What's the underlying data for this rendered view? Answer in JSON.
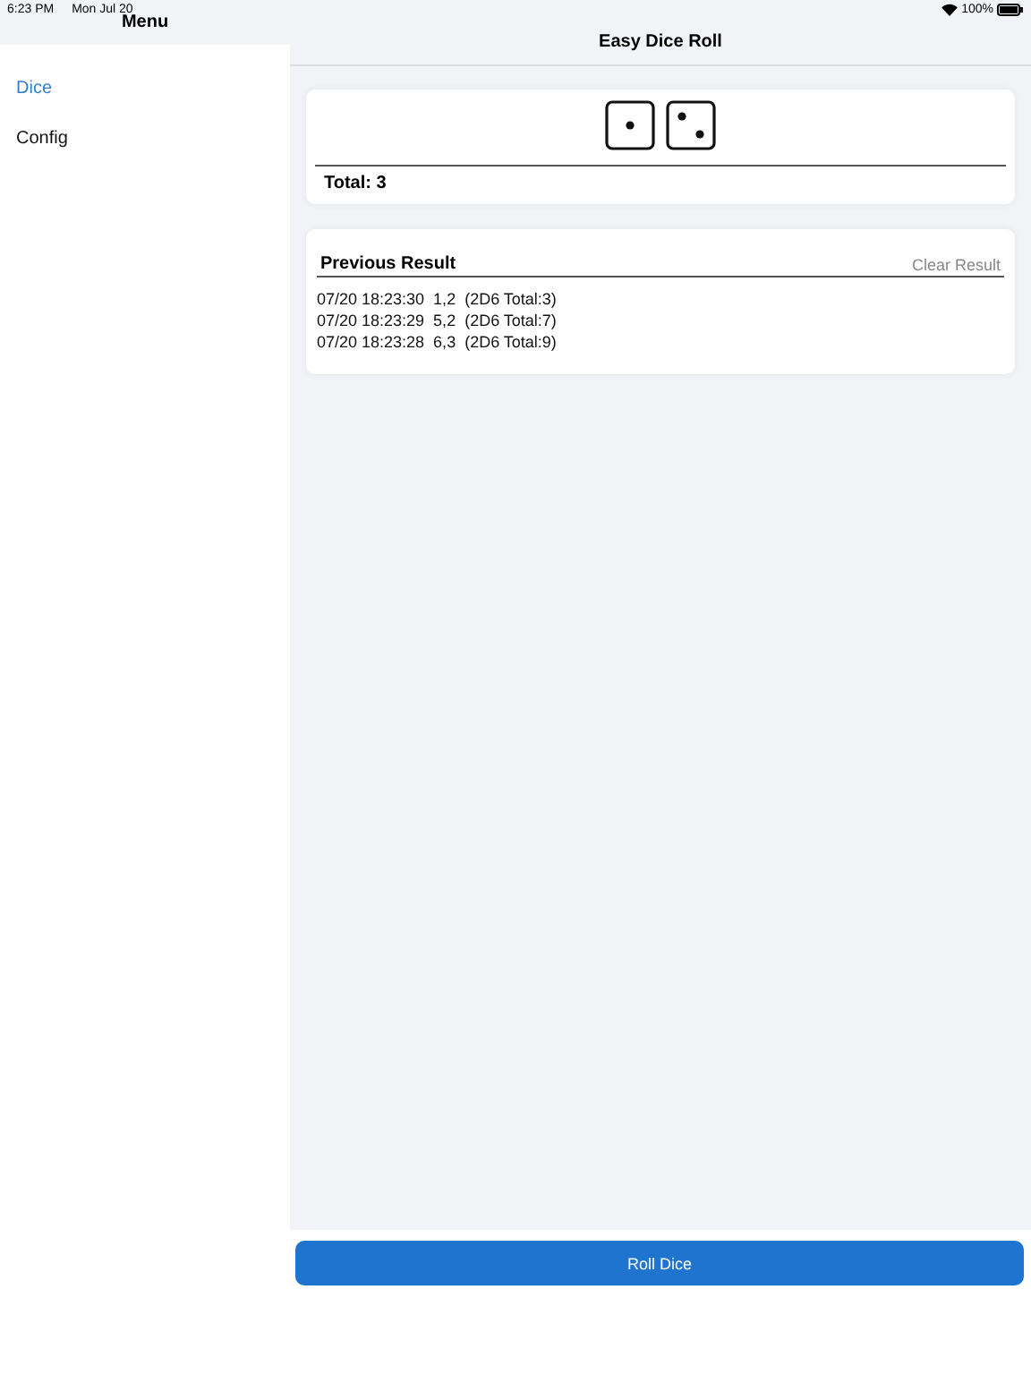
{
  "status_bar": {
    "time": "6:23 PM",
    "date": "Mon Jul 20",
    "battery": "100%"
  },
  "sidebar": {
    "title": "Menu",
    "items": [
      {
        "label": "Dice",
        "selected": true
      },
      {
        "label": "Config",
        "selected": false
      }
    ]
  },
  "nav": {
    "title": "Easy Dice Roll"
  },
  "roll": {
    "dice": [
      {
        "kind": "one"
      },
      {
        "kind": "two"
      }
    ],
    "total": "Total: 3"
  },
  "history": {
    "title": "Previous Result",
    "clear": "Clear Result",
    "rows": [
      "07/20 18:23:30  1,2  (2D6 Total:3)",
      "07/20 18:23:29  5,2  (2D6 Total:7)",
      "07/20 18:23:28  6,3  (2D6 Total:9)"
    ]
  },
  "button": "Roll Dice"
}
